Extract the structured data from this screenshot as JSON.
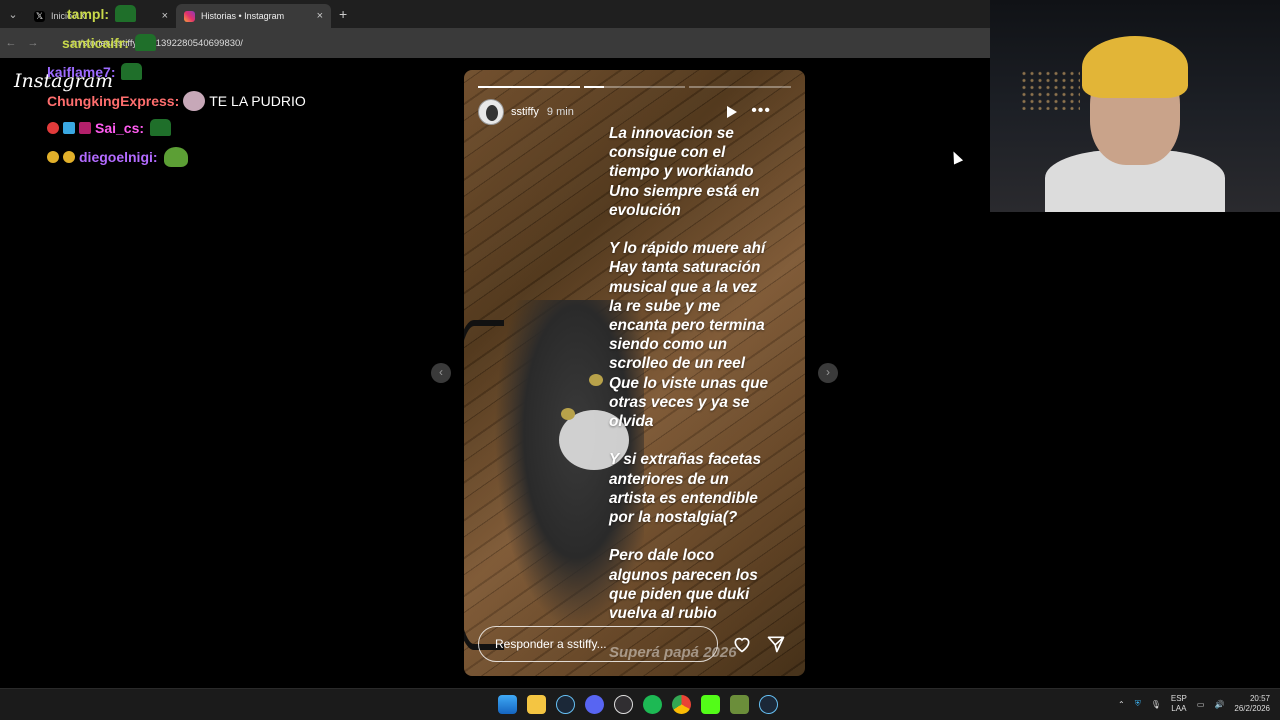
{
  "browser": {
    "tabs": [
      {
        "title": "Inicio / X",
        "active": false
      },
      {
        "title": "Historias • Instagram",
        "active": true
      }
    ],
    "new_tab": "+",
    "url": "m/stories/sstiffy/3841392280540699830/"
  },
  "page": {
    "logo_text": "Instagram"
  },
  "chat": [
    {
      "user": "tampl",
      "text": ":",
      "color": "#c8d94a"
    },
    {
      "user": "santicaifr:",
      "text": "",
      "color": "#c8d94a"
    },
    {
      "user": "kaiflame7:",
      "text": "",
      "color": "#9d6bff"
    },
    {
      "user": "ChungkingExpress:",
      "text": "TE LA PUDRIO",
      "color": "#ff6e6e"
    },
    {
      "user": "Sai_cs:",
      "text": "",
      "color": "#ff5cf0"
    },
    {
      "user": "diegoelnigi:",
      "text": "",
      "color": "#b36bff"
    }
  ],
  "story": {
    "username": "sstiffy",
    "time_ago": "9 min",
    "text": "La innovacion se\nconsigue con el\ntiempo y workiando\nUno siempre está en\nevolución\n\nY lo rápido muere ahí\nHay tanta saturación\nmusical que a la vez\nla re sube y me\nencanta pero termina\nsiendo como un\nscrolleo de un reel\nQue lo viste unas que\notras veces y ya se\nolvida\n\nY si extrañas facetas\nanteriores de un\nartista es entendible\npor la nostalgia(?\n\nPero dale loco\nalgunos parecen los\nque piden que duki\nvuelva al rubio",
    "watermark": "Superá papá 2026",
    "reply_placeholder": "Responder a sstiffy...",
    "progress": {
      "segments": 3,
      "current": 2,
      "current_fill": 0.2
    }
  },
  "taskbar": {
    "lang": "ESP",
    "lang_sub": "LAA",
    "time": "20:57",
    "date": "26/2/2026"
  },
  "colors": {
    "tabbar_bg": "#1f1f1f",
    "addrbar_bg": "#3a3a3a",
    "taskbar_bg": "#1b1b1b"
  }
}
